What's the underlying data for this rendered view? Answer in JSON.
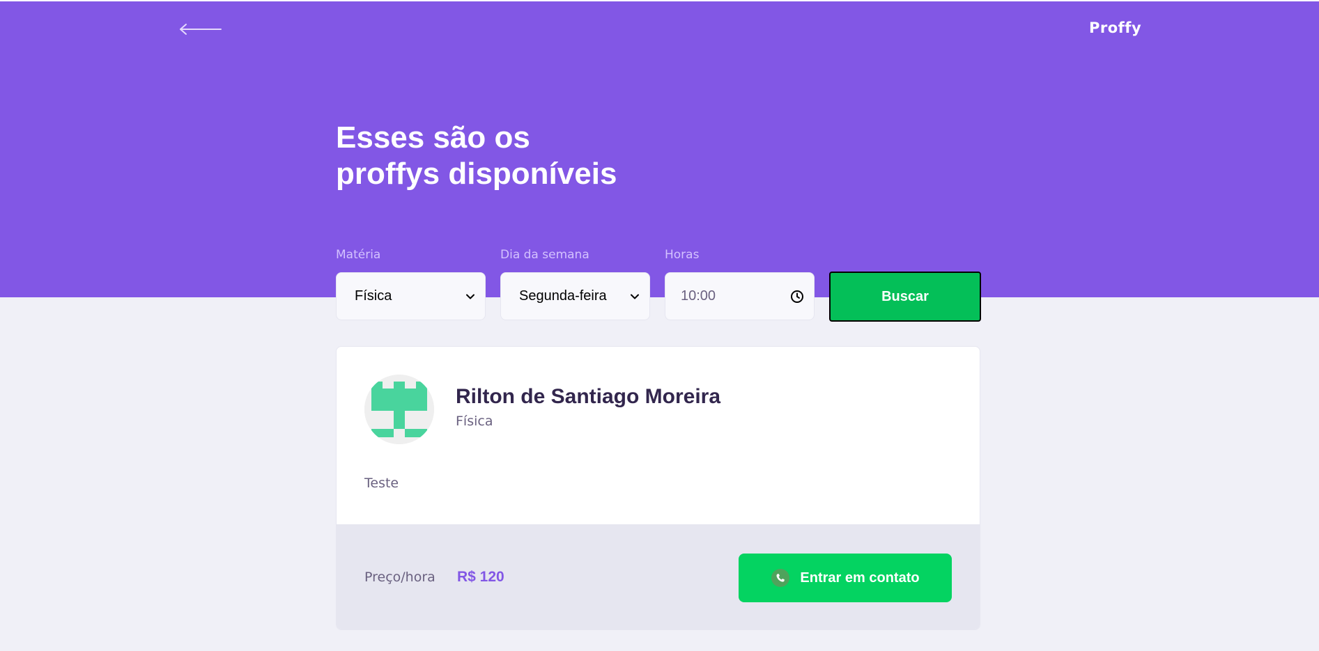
{
  "header": {
    "logo": "Proffy",
    "back_icon": "arrow-left-icon",
    "title_line1": "Esses são os",
    "title_line2": "proffys disponíveis"
  },
  "filters": {
    "subject": {
      "label": "Matéria",
      "value": "Física",
      "icon": "chevron-down-icon"
    },
    "week_day": {
      "label": "Dia da semana",
      "value": "Segunda-feira",
      "icon": "chevron-down-icon"
    },
    "time": {
      "label": "Horas",
      "value": "10:00",
      "icon": "clock-icon"
    },
    "submit_label": "Buscar"
  },
  "teachers": [
    {
      "name": "Rilton de Santiago Moreira",
      "subject": "Física",
      "bio": "Teste",
      "price_label": "Preço/hora",
      "price_value": "R$ 120",
      "contact_label": "Entrar em contato",
      "contact_icon": "whatsapp-icon"
    }
  ],
  "colors": {
    "primary": "#8257E5",
    "background": "#F0F0F7",
    "secondary": "#04D361",
    "search_button": "#04BF58",
    "title_text": "#32264D",
    "body_text": "#6A6180",
    "label_text": "#D4C2FF"
  }
}
